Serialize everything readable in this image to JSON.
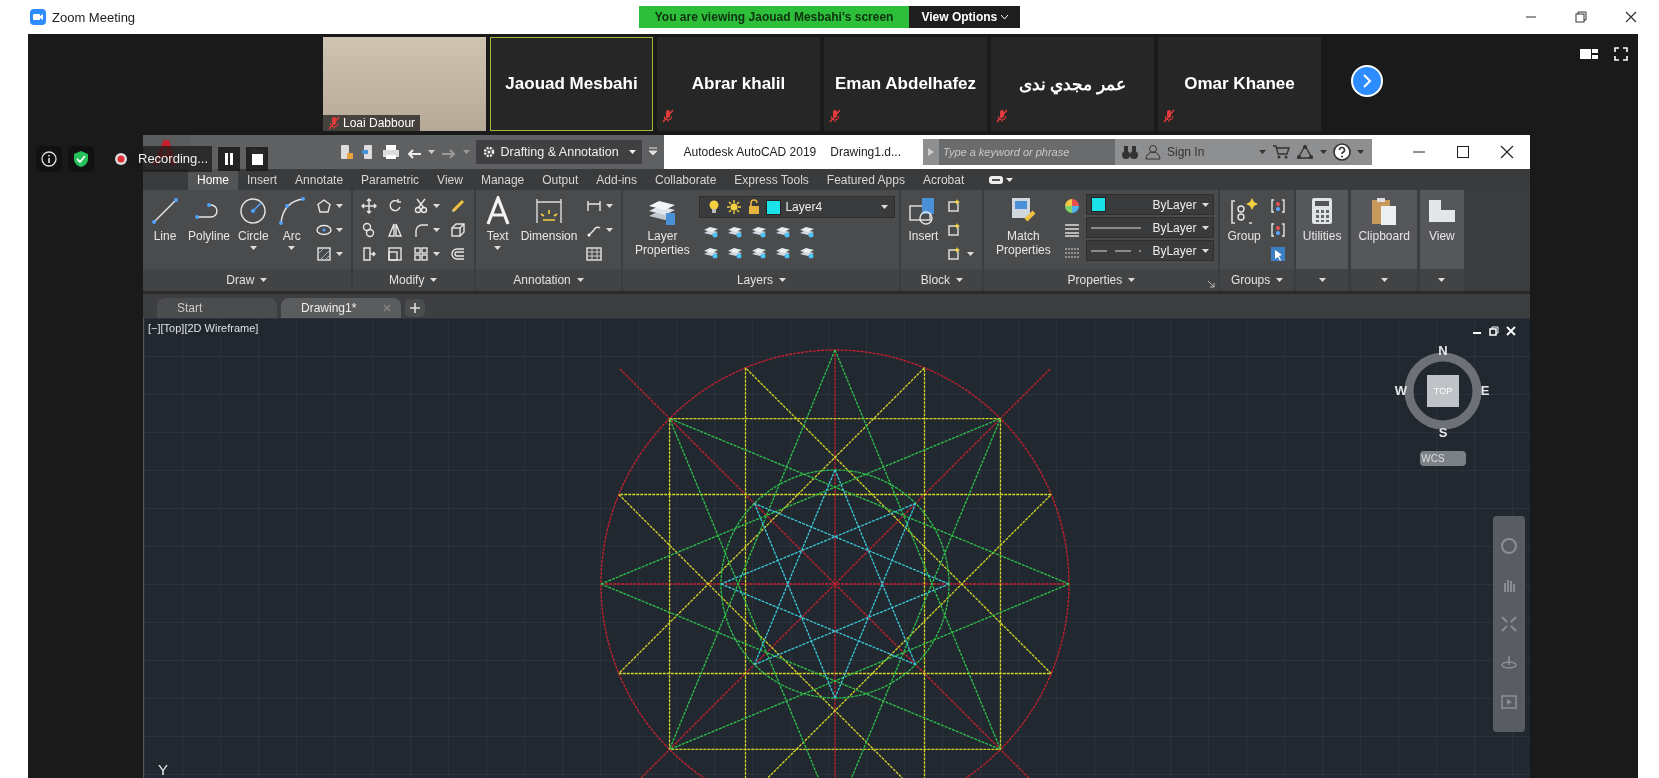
{
  "window": {
    "title": "Zoom Meeting"
  },
  "share_banner": {
    "text": "You are viewing Jaouad Mesbahi's screen",
    "button": "View Options"
  },
  "participants": [
    {
      "name": "Loai Dabbour",
      "kind": "video",
      "muted": true,
      "active": false
    },
    {
      "name": "Jaouad Mesbahi",
      "kind": "name",
      "muted": false,
      "active": true
    },
    {
      "name": "Abrar khalil",
      "kind": "name",
      "muted": true,
      "active": false
    },
    {
      "name": "Eman Abdelhafez",
      "kind": "name",
      "muted": true,
      "active": false
    },
    {
      "name": "عمر مجدي ندى",
      "kind": "name",
      "muted": true,
      "active": false
    },
    {
      "name": "Omar Khanee",
      "kind": "name",
      "muted": true,
      "active": false
    }
  ],
  "recording": {
    "label": "Recording..."
  },
  "autocad": {
    "workspace": "Drafting & Annotation",
    "title": "Autodesk AutoCAD 2019",
    "document": "Drawing1.d...",
    "search": {
      "placeholder": "Type a keyword or phrase"
    },
    "sign_in": "Sign In",
    "ribbon_tabs": [
      {
        "label": "Home",
        "selected": true
      },
      {
        "label": "Insert",
        "selected": false
      },
      {
        "label": "Annotate",
        "selected": false
      },
      {
        "label": "Parametric",
        "selected": false
      },
      {
        "label": "View",
        "selected": false
      },
      {
        "label": "Manage",
        "selected": false
      },
      {
        "label": "Output",
        "selected": false
      },
      {
        "label": "Add-ins",
        "selected": false
      },
      {
        "label": "Collaborate",
        "selected": false
      },
      {
        "label": "Express Tools",
        "selected": false
      },
      {
        "label": "Featured Apps",
        "selected": false
      },
      {
        "label": "Acrobat",
        "selected": false
      }
    ],
    "panels": [
      {
        "kind": "draw",
        "title": "Draw",
        "tools": [
          "Line",
          "Polyline",
          "Circle",
          "Arc"
        ]
      },
      {
        "kind": "modify",
        "title": "Modify"
      },
      {
        "kind": "annotation",
        "title": "Annotation",
        "tools": [
          "Text",
          "Dimension"
        ]
      },
      {
        "kind": "layers",
        "title": "Layers",
        "tools": [
          "Layer Properties"
        ],
        "layer": "Layer4"
      },
      {
        "kind": "block",
        "title": "Block",
        "tools": [
          "Insert"
        ]
      },
      {
        "kind": "properties",
        "title": "Properties",
        "tools": [
          "Match Properties"
        ],
        "dropdowns": [
          "ByLayer",
          "ByLayer",
          "ByLayer"
        ]
      },
      {
        "kind": "groups",
        "title": "Groups",
        "tools": [
          "Group"
        ]
      },
      {
        "kind": "single",
        "tools": [
          "Utilities"
        ]
      },
      {
        "kind": "single",
        "tools": [
          "Clipboard"
        ]
      },
      {
        "kind": "single",
        "tools": [
          "View"
        ]
      }
    ],
    "doc_tabs": [
      {
        "label": "Start",
        "selected": false
      },
      {
        "label": "Drawing1*",
        "selected": true
      }
    ],
    "viewport": {
      "label": "[−][Top][2D Wireframe]",
      "compass": [
        "N",
        "E",
        "S",
        "W"
      ],
      "face": "TOP",
      "ucs": "WCS",
      "axis": "Y"
    }
  }
}
